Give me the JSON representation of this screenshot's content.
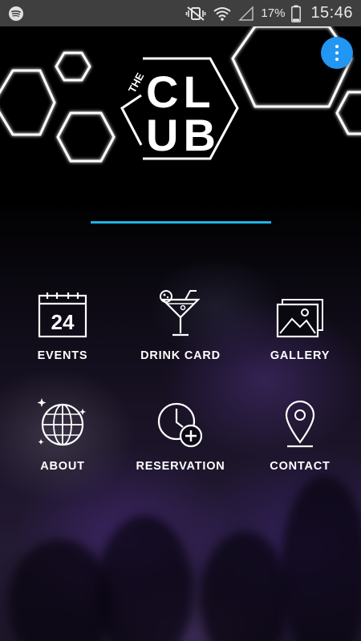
{
  "status_bar": {
    "battery_percent": "17%",
    "time": "15:46",
    "icons": [
      "spotify-icon",
      "mute-vibrate-icon",
      "wifi-icon",
      "signal-icon",
      "battery-icon"
    ]
  },
  "header": {
    "logo_small": "THE",
    "logo_line1": "CL",
    "logo_line2": "UB",
    "menu_icon": "more-vert-icon",
    "accent_color": "#1fb3e6",
    "fab_color": "#2196f3"
  },
  "menu": {
    "items": [
      {
        "label": "EVENTS",
        "icon": "calendar-icon",
        "badge": "24"
      },
      {
        "label": "DRINK CARD",
        "icon": "cocktail-icon"
      },
      {
        "label": "GALLERY",
        "icon": "gallery-icon"
      },
      {
        "label": "ABOUT",
        "icon": "globe-icon"
      },
      {
        "label": "RESERVATION",
        "icon": "clock-plus-icon"
      },
      {
        "label": "CONTACT",
        "icon": "location-pin-icon"
      }
    ]
  }
}
